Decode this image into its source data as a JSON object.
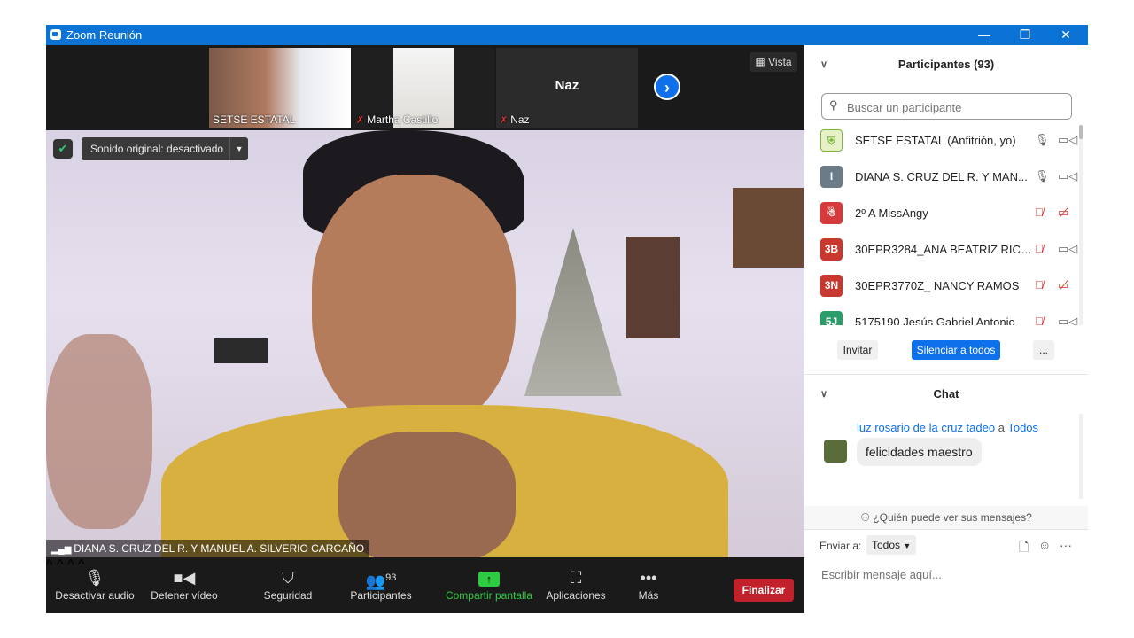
{
  "window": {
    "title": "Zoom Reunión",
    "min_glyph": "—",
    "max_glyph": "❐",
    "close_glyph": "✕"
  },
  "strip": {
    "thumbnails": [
      {
        "name": "SETSE ESTATAL",
        "muted": false
      },
      {
        "name": "Martha Castillo",
        "muted": true
      },
      {
        "name": "Naz",
        "muted": true,
        "big_label": "Naz"
      }
    ],
    "next_glyph": "›",
    "vista_label": "Vista",
    "vista_icon": "▦"
  },
  "video": {
    "sonido_label": "Sonido original: desactivado",
    "shield_glyph": "✔",
    "speaker_name": "DIANA  S. CRUZ DEL R. Y MANUEL A. SILVERIO CARCAÑO"
  },
  "toolbar": {
    "audio_label": "Desactivar audio",
    "video_label": "Detener vídeo",
    "security_label": "Seguridad",
    "participants_label": "Participantes",
    "participants_count": "93",
    "share_label": "Compartir pantalla",
    "apps_label": "Aplicaciones",
    "more_label": "Más",
    "end_label": "Finalizar",
    "caret": "^",
    "share_color": "#2ecc40"
  },
  "participants": {
    "title": "Participantes (93)",
    "search_placeholder": "Buscar un participante",
    "list": [
      {
        "avatar": "",
        "avatar_color": "#7ab53e",
        "name": "SETSE ESTATAL (Anfitrión, yo)",
        "mic_muted": false,
        "cam_off": false
      },
      {
        "avatar": "I",
        "avatar_color": "#6b7b88",
        "name": "DIANA  S. CRUZ DEL R. Y MAN...",
        "mic_muted": false,
        "cam_off": false
      },
      {
        "avatar": "",
        "avatar_color": "#d63a3a",
        "name": "2º A  MissAngy",
        "mic_muted": true,
        "cam_off": true
      },
      {
        "avatar": "3B",
        "avatar_color": "#c9382e",
        "name": "30EPR3284_ANA BEATRIZ RICAR...",
        "mic_muted": true,
        "cam_off": false
      },
      {
        "avatar": "3N",
        "avatar_color": "#c9382e",
        "name": "30EPR3770Z_ NANCY RAMOS",
        "mic_muted": true,
        "cam_off": true
      },
      {
        "avatar": "5J",
        "avatar_color": "#2a9d6a",
        "name": "5175190 Jesús Gabriel Antonio",
        "mic_muted": true,
        "cam_off": false
      }
    ],
    "invite_label": "Invitar",
    "mute_all_label": "Silenciar a todos",
    "more_label": "..."
  },
  "chat": {
    "title": "Chat",
    "sender": "luz rosario de la cruz tadeo",
    "to_word": "a",
    "recipient": "Todos",
    "message": "felicidades maestro",
    "who_sees": "¿Quién puede ver sus mensajes?",
    "send_to_label": "Enviar a:",
    "send_to_value": "Todos",
    "input_placeholder": "Escribir mensaje aquí..."
  }
}
